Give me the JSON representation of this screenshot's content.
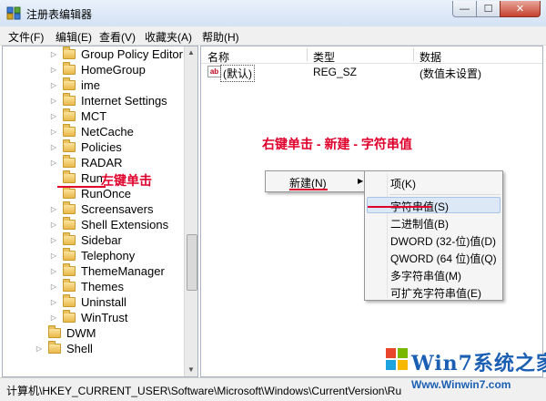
{
  "window": {
    "title": "注册表编辑器",
    "min_glyph": "—",
    "max_glyph": "☐",
    "close_glyph": "✕",
    "app_icon": "registry-icon"
  },
  "menu": [
    "文件(F)",
    "编辑(E)",
    "查看(V)",
    "收藏夹(A)",
    "帮助(H)"
  ],
  "tree": {
    "items": [
      "Group Policy Editor",
      "HomeGroup",
      "ime",
      "Internet Settings",
      "MCT",
      "NetCache",
      "Policies",
      "RADAR",
      "Run",
      "RunOnce",
      "Screensavers",
      "Shell Extensions",
      "Sidebar",
      "Telephony",
      "ThemeManager",
      "Themes",
      "Uninstall",
      "WinTrust"
    ],
    "parent_items": [
      "DWM",
      "Shell"
    ],
    "annotation": "左键单击"
  },
  "list": {
    "headers": [
      "名称",
      "类型",
      "数据"
    ],
    "row": {
      "icon": "ab",
      "name": "(默认)",
      "type": "REG_SZ",
      "data": "(数值未设置)"
    },
    "annotation": "右键单击 - 新建 - 字符串值"
  },
  "context_menu": {
    "new_label": "新建(N)",
    "submenu": [
      "项(K)",
      "字符串值(S)",
      "二进制值(B)",
      "DWORD (32-位)值(D)",
      "QWORD (64 位)值(Q)",
      "多字符串值(M)",
      "可扩充字符串值(E)"
    ]
  },
  "status": "计算机\\HKEY_CURRENT_USER\\Software\\Microsoft\\Windows\\CurrentVersion\\Ru",
  "watermark": {
    "brand": "Win7系统之家",
    "url": "Www.Winwin7.com"
  },
  "colors": {
    "annotation": "#e0002c",
    "watermark": "#1a5fb4",
    "selection": "#dce8f6"
  }
}
